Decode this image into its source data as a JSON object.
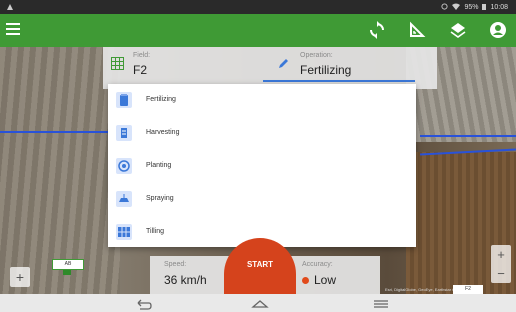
{
  "status": {
    "battery": "95%",
    "time": "10:08"
  },
  "colors": {
    "app_bar": "#3f9a35",
    "accent": "#3b78d8",
    "start": "#d5431c",
    "low_indicator": "#e14a1a",
    "boundary": "#2952d9"
  },
  "app_bar": {
    "icons": [
      "menu-icon",
      "sync-icon",
      "area-measure-icon",
      "layers-icon",
      "account-icon"
    ]
  },
  "header": {
    "field": {
      "label": "Field:",
      "value": "F2",
      "icon": "grid-icon"
    },
    "operation": {
      "label": "Operation:",
      "value": "Fertilizing",
      "icon": "pencil-icon"
    }
  },
  "operation_menu": {
    "items": [
      {
        "label": "Fertilizing",
        "icon": "fertilizer-bag-icon"
      },
      {
        "label": "Harvesting",
        "icon": "harvester-icon"
      },
      {
        "label": "Planting",
        "icon": "seed-icon"
      },
      {
        "label": "Spraying",
        "icon": "sprayer-icon"
      },
      {
        "label": "Tilling",
        "icon": "tiller-icon"
      }
    ]
  },
  "footer": {
    "speed": {
      "label": "Speed:",
      "value": "36 km/h"
    },
    "start_label": "START",
    "accuracy": {
      "label": "Accuracy:",
      "value": "Low"
    }
  },
  "map": {
    "zoom_in": "+",
    "zoom_out": "−",
    "add_label": "+",
    "badge_text": "AB",
    "field_tag": "F2",
    "attribution": "Esri, DigitalGlobe, GeoEye, Earthstar Geographics"
  },
  "nav": {
    "icons": [
      "back-icon",
      "home-icon",
      "recents-icon"
    ]
  }
}
